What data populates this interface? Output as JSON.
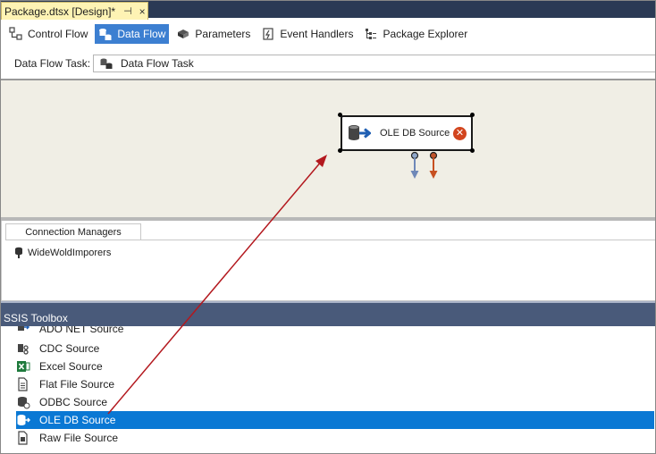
{
  "document_tab": {
    "title": "Package.dtsx [Design]*",
    "pin_icon": "pin-icon",
    "close_label": "×"
  },
  "designer_tabs": [
    {
      "label": "Control Flow",
      "icon": "control-flow-icon",
      "active": false
    },
    {
      "label": "Data Flow",
      "icon": "data-flow-icon",
      "active": true
    },
    {
      "label": "Parameters",
      "icon": "parameters-icon",
      "active": false
    },
    {
      "label": "Event Handlers",
      "icon": "event-handlers-icon",
      "active": false
    },
    {
      "label": "Package Explorer",
      "icon": "package-explorer-icon",
      "active": false
    }
  ],
  "task_bar": {
    "label": "Data Flow Task:",
    "selected_task": "Data Flow Task"
  },
  "design_surface": {
    "component": {
      "label": "OLE DB Source",
      "status_icon": "error-icon",
      "status_glyph": "✕"
    }
  },
  "connection_managers": {
    "tab_label": "Connection Managers",
    "items": [
      {
        "label": "WideWoldImporers",
        "icon": "connection-icon"
      }
    ]
  },
  "toolbox": {
    "title": "SSIS Toolbox",
    "items": [
      {
        "label": "ADO NET Source",
        "icon": "ado-net-source-icon",
        "selected": false
      },
      {
        "label": "CDC Source",
        "icon": "cdc-source-icon",
        "selected": false
      },
      {
        "label": "Excel Source",
        "icon": "excel-source-icon",
        "selected": false
      },
      {
        "label": "Flat File Source",
        "icon": "flat-file-source-icon",
        "selected": false
      },
      {
        "label": "ODBC Source",
        "icon": "odbc-source-icon",
        "selected": false
      },
      {
        "label": "OLE DB Source",
        "icon": "ole-db-source-icon",
        "selected": true
      },
      {
        "label": "Raw File Source",
        "icon": "raw-file-source-icon",
        "selected": false
      }
    ]
  },
  "colors": {
    "accent": "#0a78d4",
    "tab_active": "#3c7fd1",
    "error": "#d2451e",
    "annotation_arrow": "#b3181e",
    "surface": "#f0eee5"
  }
}
